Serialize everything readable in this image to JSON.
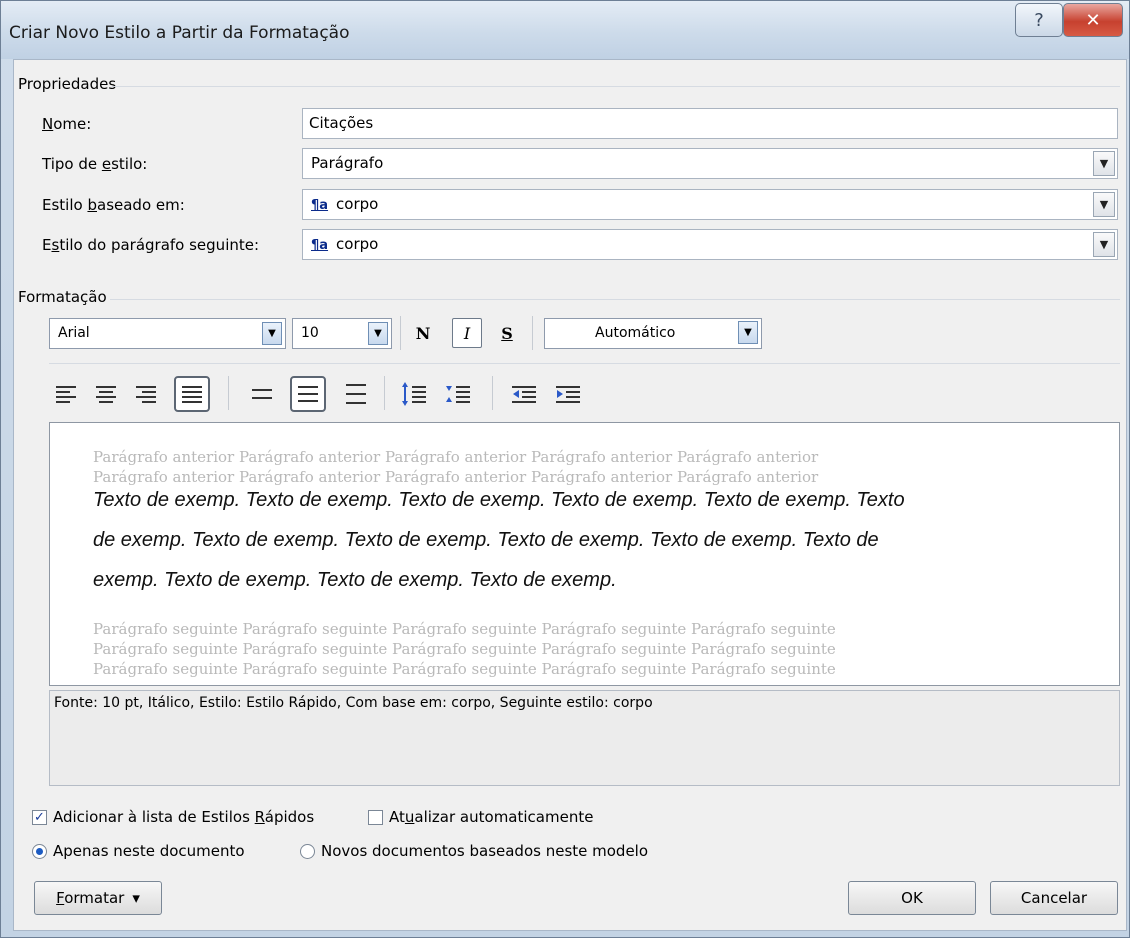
{
  "window": {
    "title": "Criar Novo Estilo a Partir da Formatação",
    "help_glyph": "?",
    "close_glyph": "✕"
  },
  "properties": {
    "group_label": "Propriedades",
    "name_label_u": "N",
    "name_label_rest": "ome:",
    "name_value": "Citações",
    "type_label_pre": "Tipo de ",
    "type_label_u": "e",
    "type_label_post": "stilo:",
    "type_value": "Parágrafo",
    "based_label_pre": "Estilo ",
    "based_label_u": "b",
    "based_label_post": "aseado em:",
    "based_value": "corpo",
    "next_label_pre": "E",
    "next_label_u": "s",
    "next_label_post": "tilo do parágrafo seguinte:",
    "next_value": "corpo",
    "style_icon": "¶a"
  },
  "formatting": {
    "group_label": "Formatação",
    "font": "Arial",
    "size": "10",
    "bold": "N",
    "italic": "I",
    "underline": "S",
    "color": "Automático"
  },
  "preview": {
    "prev_line_1": "Parágrafo anterior Parágrafo anterior Parágrafo anterior Parágrafo anterior Parágrafo anterior",
    "prev_line_2": "Parágrafo anterior Parágrafo anterior Parágrafo anterior Parágrafo anterior Parágrafo anterior",
    "sample_line_1": "Texto de exemp. Texto de exemp. Texto de exemp. Texto de exemp. Texto de exemp. Texto",
    "sample_line_2": "de exemp. Texto de exemp. Texto de exemp. Texto de exemp. Texto de exemp. Texto de",
    "sample_line_3": "exemp. Texto de exemp. Texto de exemp. Texto de exemp.",
    "next_line_1": "Parágrafo seguinte Parágrafo seguinte Parágrafo seguinte Parágrafo seguinte Parágrafo seguinte",
    "next_line_2": "Parágrafo seguinte Parágrafo seguinte Parágrafo seguinte Parágrafo seguinte Parágrafo seguinte"
  },
  "description": "Fonte: 10 pt, Itálico, Estilo: Estilo Rápido, Com base em: corpo, Seguinte estilo: corpo",
  "options": {
    "add_quick_pre": "Adicionar à lista de Estilos ",
    "add_quick_u": "R",
    "add_quick_post": "ápidos",
    "add_quick_checked": true,
    "auto_update_pre": "At",
    "auto_update_u": "u",
    "auto_update_post": "alizar automaticamente",
    "auto_update_checked": false,
    "only_doc": "Apenas neste documento",
    "new_docs": "Novos documentos baseados neste modelo",
    "selected_scope": "only_doc"
  },
  "buttons": {
    "format_u": "F",
    "format_rest": "ormatar",
    "format_arrow": "▾",
    "ok": "OK",
    "cancel": "Cancelar"
  }
}
